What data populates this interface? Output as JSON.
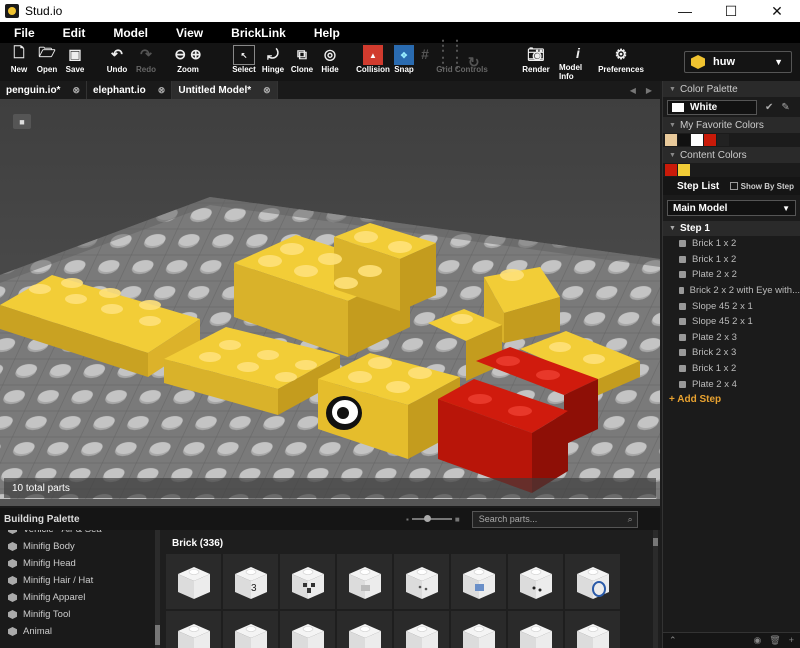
{
  "window": {
    "title": "Stud.io",
    "minimize": "—",
    "maximize": "☐",
    "close": "✕"
  },
  "menu": [
    "File",
    "Edit",
    "Model",
    "View",
    "BrickLink",
    "Help"
  ],
  "toolbar": {
    "new": "New",
    "open": "Open",
    "save": "Save",
    "undo": "Undo",
    "redo": "Redo",
    "zoom": "Zoom",
    "select": "Select",
    "hinge": "Hinge",
    "clone": "Clone",
    "hide": "Hide",
    "collision": "Collision",
    "snap": "Snap",
    "grid_controls": "Grid Controls",
    "render": "Render",
    "model_info": "Model Info",
    "preferences": "Preferences"
  },
  "user": {
    "name": "huw"
  },
  "tabs": [
    {
      "label": "penguin.io*",
      "close": "⊗"
    },
    {
      "label": "elephant.io",
      "close": "⊗"
    },
    {
      "label": "Untitled Model*",
      "close": "⊗"
    }
  ],
  "tab_nav": {
    "prev": "◀",
    "next": "▶"
  },
  "viewport": {
    "status": "10 total parts"
  },
  "color_palette": {
    "header": "Color Palette",
    "selected": "White",
    "favorites_header": "My Favorite Colors",
    "favorites": [
      "#e8c99a",
      "#111111",
      "#ffffff",
      "#c91a09",
      "#222222"
    ],
    "content_header": "Content Colors",
    "content": [
      "#c91a09",
      "#f2cd37"
    ]
  },
  "step_list": {
    "header": "Step List",
    "show_by_step": "Show By Step",
    "model": "Main Model",
    "step": "Step 1",
    "items": [
      "Brick 1 x 2",
      "Brick 1 x 2",
      "Plate 2 x 2",
      "Brick 2 x 2 with Eye with...",
      "Slope 45 2 x 1",
      "Slope 45 2 x 1",
      "Plate 2 x 3",
      "Brick 2 x 3",
      "Brick 1 x 2",
      "Plate 2 x 4"
    ],
    "add_step": "+ Add Step"
  },
  "building_palette": {
    "header": "Building Palette",
    "search_placeholder": "Search parts...",
    "categories": [
      "Vehicle - Air & Sea",
      "Minifig Body",
      "Minifig Head",
      "Minifig Hair / Hat",
      "Minifig Apparel",
      "Minifig Tool",
      "Animal"
    ],
    "group": "Brick (336)",
    "thumbs": [
      "brick",
      "brick-3",
      "brick-creeper",
      "brick-tile",
      "brick-dots",
      "brick-blue",
      "brick-eyes",
      "brick-ring",
      "brick",
      "brick",
      "brick",
      "brick",
      "brick",
      "brick",
      "brick",
      "brick"
    ]
  }
}
